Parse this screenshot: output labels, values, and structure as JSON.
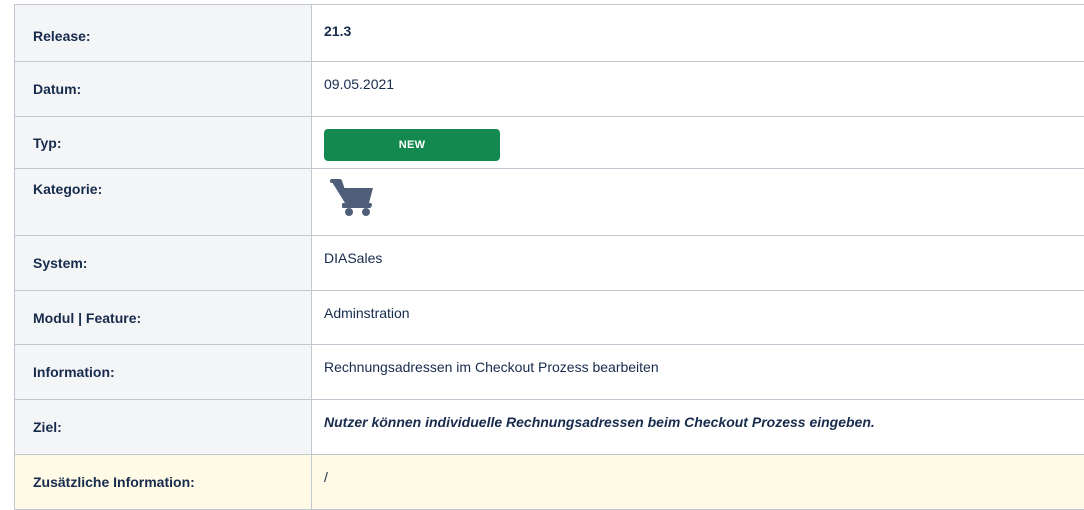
{
  "rows": {
    "release": {
      "label": "Release:",
      "value": "21.3"
    },
    "datum": {
      "label": "Datum:",
      "value": "09.05.2021"
    },
    "typ": {
      "label": "Typ:",
      "badge": "NEW",
      "badge_color": "#14894f"
    },
    "kategorie": {
      "label": "Kategorie:",
      "icon": "shopping-cart-icon"
    },
    "system": {
      "label": "System:",
      "value": "DIASales"
    },
    "modul": {
      "label": "Modul | Feature:",
      "value": "Adminstration"
    },
    "information": {
      "label": "Information:",
      "value": "Rechnungsadressen im Checkout Prozess bearbeiten"
    },
    "ziel": {
      "label": "Ziel:",
      "value": "Nutzer können individuelle Rechnungsadressen beim Checkout Prozess eingeben."
    },
    "zusatz": {
      "label": "Zusätzliche Information:",
      "value": "/",
      "highlight_color": "#fffae6"
    }
  }
}
